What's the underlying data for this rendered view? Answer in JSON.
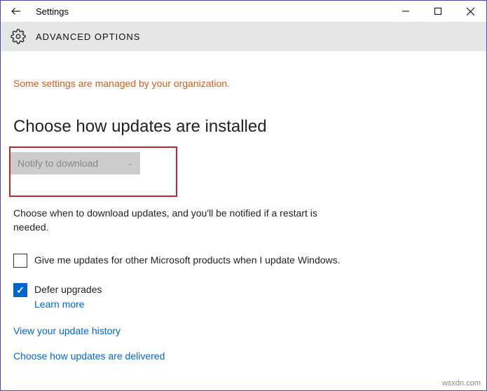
{
  "titlebar": {
    "title": "Settings"
  },
  "header": {
    "title": "ADVANCED OPTIONS"
  },
  "managed_message": "Some settings are managed by your organization.",
  "section": {
    "title": "Choose how updates are installed",
    "dropdown_value": "Notify to download",
    "description": "Choose when to download updates, and you'll be notified if a restart is needed."
  },
  "checkboxes": {
    "other_products": {
      "label": "Give me updates for other Microsoft products when I update Windows.",
      "checked": false
    },
    "defer": {
      "label": "Defer upgrades",
      "learn_more": "Learn more",
      "checked": true
    }
  },
  "links": {
    "history": "View your update history",
    "delivery": "Choose how updates are delivered"
  },
  "watermark": "wsxdn.com"
}
